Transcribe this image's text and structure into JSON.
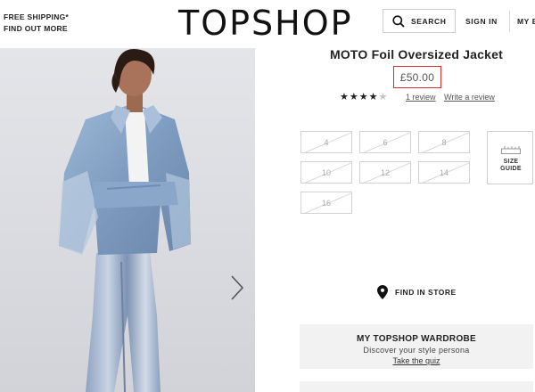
{
  "header": {
    "promo_line1": "FREE SHIPPING*",
    "promo_line2": "FIND OUT MORE",
    "logo": "TOPSHOP",
    "search_label": "SEARCH",
    "signin_label": "SIGN IN",
    "bag_label": "MY B",
    "icons": {
      "search": "search-icon"
    }
  },
  "product": {
    "title": "MOTO Foil Oversized Jacket",
    "price": "£50.00",
    "rating_stars": 4,
    "rating_max": 5,
    "reviews_link": "1 review",
    "write_review_link": "Write a review",
    "price_highlight_color": "#d0302f"
  },
  "sizes": {
    "options": [
      "4",
      "6",
      "8",
      "10",
      "12",
      "14",
      "16"
    ],
    "all_unavailable": true,
    "guide_line1": "SIZE",
    "guide_line2": "GUIDE"
  },
  "store": {
    "find_label": "FIND IN STORE",
    "icon": "location-pin-icon"
  },
  "wardrobe": {
    "title": "MY TOPSHOP WARDROBE",
    "subtitle": "Discover your style persona",
    "link": "Take the quiz"
  },
  "gallery": {
    "next_icon": "chevron-right-icon"
  }
}
